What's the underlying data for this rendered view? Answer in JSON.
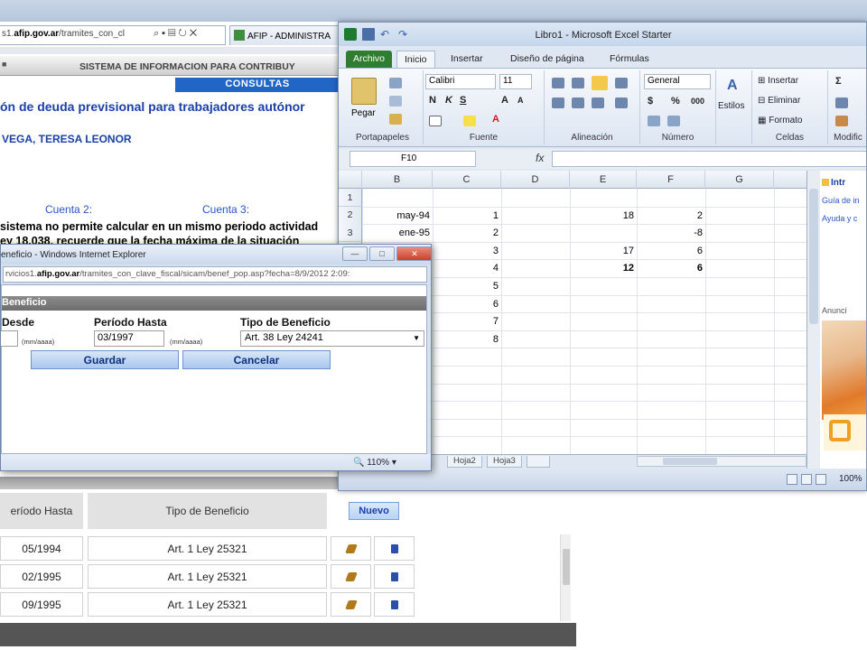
{
  "ie_background": {
    "address": {
      "prefix": "s1.",
      "domain": "afip.gov.ar",
      "path": "/tramites_con_cl"
    },
    "tab_label": "AFIP - ADMINISTRA",
    "section_header": "SISTEMA DE INFORMACION PARA CONTRIBUY",
    "consultas_label": "CONSULTAS",
    "page_title": "ón de deuda previsional para trabajadores autónor",
    "person_name": "VEGA, TERESA LEONOR",
    "cuenta2_label": "Cuenta 2:",
    "cuenta3_label": "Cuenta 3:",
    "warning_line1": "sistema no permite calcular en un mismo periodo actividad",
    "warning_line2": "ey 18.038, recuerde que la fecha máxima de la situación",
    "table": {
      "headers": [
        "eríodo Hasta",
        "Tipo de Beneficio"
      ],
      "nuevo_label": "Nuevo",
      "rows": [
        {
          "hasta": "05/1994",
          "tipo": "Art. 1 Ley 25321"
        },
        {
          "hasta": "02/1995",
          "tipo": "Art. 1 Ley 25321"
        },
        {
          "hasta": "09/1995",
          "tipo": "Art. 1 Ley 25321"
        }
      ]
    }
  },
  "excel": {
    "window_title": "Libro1 - Microsoft Excel Starter",
    "tabs": [
      "Archivo",
      "Inicio",
      "Insertar",
      "Diseño de página",
      "Fórmulas"
    ],
    "ribbon": {
      "paste_label": "Pegar",
      "font_name": "Calibri",
      "font_size": "11",
      "number_format": "General",
      "estilos_label": "Estilos",
      "insertar_label": "Insertar",
      "eliminar_label": "Eliminar",
      "formato_label": "Formato",
      "groups": [
        "Portapapeles",
        "Fuente",
        "Alineación",
        "Número",
        "Celdas",
        "Modific"
      ]
    },
    "name_box": "F10",
    "fx_label": "fx",
    "columns": [
      "B",
      "C",
      "D",
      "E",
      "F",
      "G"
    ],
    "rows": [
      {
        "n": "1",
        "B": "",
        "C": "",
        "E": "",
        "F": ""
      },
      {
        "n": "2",
        "B": "may-94",
        "C": "1",
        "E": "18",
        "F": "2"
      },
      {
        "n": "3",
        "B": "ene-95",
        "C": "2",
        "E": "",
        "F": "-8"
      },
      {
        "n": "",
        "B": "",
        "C": "3",
        "E": "17",
        "F": "6"
      },
      {
        "n": "",
        "B": "",
        "C": "4",
        "E": "12",
        "F": "6"
      },
      {
        "n": "",
        "B": "",
        "C": "5",
        "E": "",
        "F": ""
      },
      {
        "n": "",
        "B": "",
        "C": "6",
        "E": "",
        "F": ""
      },
      {
        "n": "",
        "B": "",
        "C": "7",
        "E": "",
        "F": ""
      },
      {
        "n": "",
        "B": "",
        "C": "8",
        "E": "",
        "F": ""
      }
    ],
    "sheet_tabs": [
      "Hoja2",
      "Hoja3"
    ],
    "zoom": "100%",
    "side_panel": {
      "intro": "Intr",
      "guia": "Guía de in",
      "ayuda": "Ayuda y c",
      "anuncio": "Anunci"
    }
  },
  "popup": {
    "title": "eneficio - Windows Internet Explorer",
    "address": {
      "prefix": "rvicios1.",
      "domain": "afip.gov.ar",
      "path": "/tramites_con_clave_fiscal/sicam/benef_pop.asp?fecha=8/9/2012 2:09:"
    },
    "section_header": "Beneficio",
    "desde_label": "Desde",
    "hasta_label": "Período Hasta",
    "tipo_label": "Tipo de Beneficio",
    "hasta_value": "03/1997",
    "format_hint": "(mm/aaaa)",
    "tipo_value": "Art. 38 Ley 24241",
    "guardar_label": "Guardar",
    "cancelar_label": "Cancelar",
    "zoom": "110%"
  }
}
